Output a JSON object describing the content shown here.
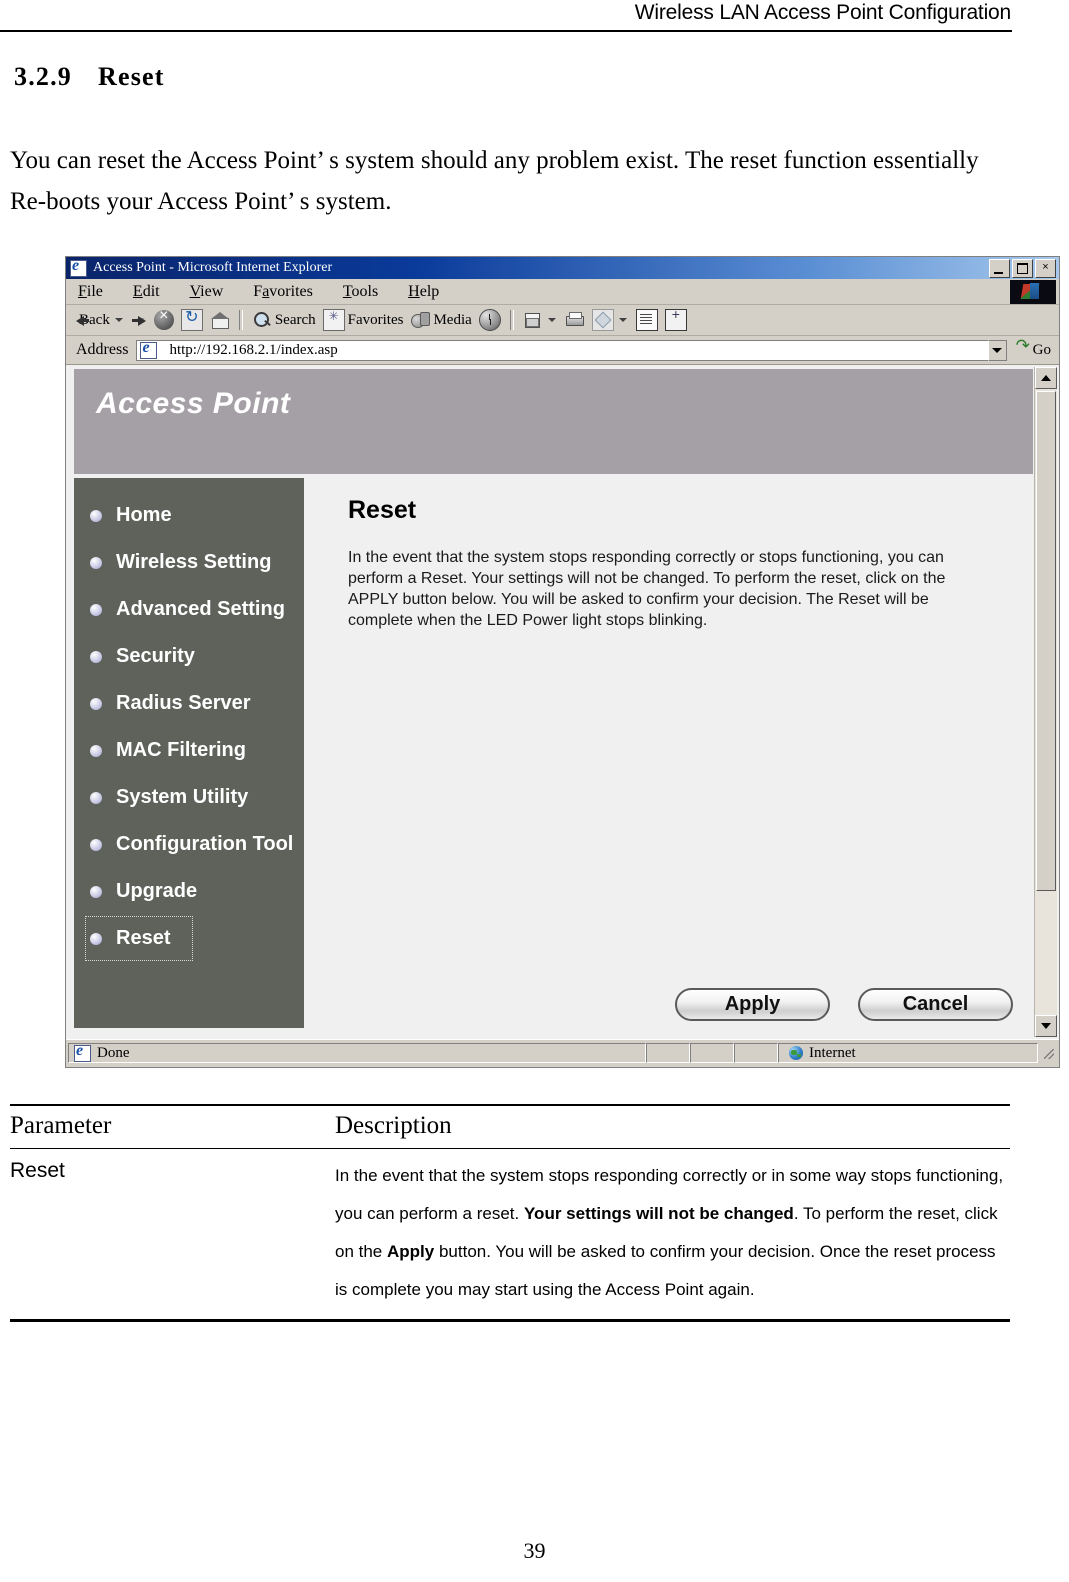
{
  "document": {
    "running_header": "Wireless LAN Access Point Configuration",
    "section_number": "3.2.9",
    "section_title": "Reset",
    "intro_paragraph": "You can reset the Access Point’ s system should any problem exist. The reset function essentially Re-boots your Access Point’ s system.",
    "page_number": "39"
  },
  "browser": {
    "window_title": "Access Point - Microsoft Internet Explorer",
    "window_buttons": {
      "minimize": "_",
      "maximize": "□",
      "close": "×"
    },
    "menu": [
      {
        "label": "File",
        "accel": "F"
      },
      {
        "label": "Edit",
        "accel": "E"
      },
      {
        "label": "View",
        "accel": "V"
      },
      {
        "label": "Favorites",
        "accel": "a"
      },
      {
        "label": "Tools",
        "accel": "T"
      },
      {
        "label": "Help",
        "accel": "H"
      }
    ],
    "toolbar": {
      "back_label": "Back",
      "search_label": "Search",
      "favorites_label": "Favorites",
      "media_label": "Media",
      "icons": [
        "back-arrow-icon",
        "back-dropdown-icon",
        "forward-arrow-icon",
        "forward-dropdown-icon",
        "stop-icon",
        "refresh-icon",
        "home-icon",
        "search-icon",
        "favorites-icon",
        "media-icon",
        "history-icon",
        "mail-icon",
        "mail-dropdown-icon",
        "print-icon",
        "edit-icon",
        "edit-dropdown-icon",
        "discuss-icon",
        "messenger-icon"
      ]
    },
    "address_bar": {
      "label": "Address",
      "url": "http://192.168.2.1/index.asp",
      "go_label": "Go"
    },
    "status_bar": {
      "status_text": "Done",
      "zone_text": "Internet"
    }
  },
  "page": {
    "banner_title": "Access Point",
    "sidebar": [
      {
        "label": "Home",
        "focused": false
      },
      {
        "label": "Wireless Setting",
        "focused": false
      },
      {
        "label": "Advanced Setting",
        "focused": false
      },
      {
        "label": "Security",
        "focused": false
      },
      {
        "label": "Radius Server",
        "focused": false
      },
      {
        "label": "MAC Filtering",
        "focused": false
      },
      {
        "label": "System Utility",
        "focused": false
      },
      {
        "label": "Configuration Tool",
        "focused": false
      },
      {
        "label": "Upgrade",
        "focused": false
      },
      {
        "label": "Reset",
        "focused": true
      }
    ],
    "main": {
      "heading": "Reset",
      "body": "In the event that the system stops responding correctly or stops functioning, you can perform a Reset. Your settings will not be changed. To perform the reset, click on the APPLY button below. You will be asked to confirm your decision. The Reset will be complete when the LED Power light stops blinking.",
      "apply_label": "Apply",
      "cancel_label": "Cancel"
    }
  },
  "parameter_table": {
    "headers": {
      "parameter": "Parameter",
      "description": "Description"
    },
    "rows": [
      {
        "parameter": "Reset",
        "description_parts": [
          {
            "text": "In the event that the system stops responding correctly or in some way stops functioning, you can perform a reset. ",
            "bold": false
          },
          {
            "text": "Your settings will not be changed",
            "bold": true
          },
          {
            "text": ". To perform the reset, click on the ",
            "bold": false
          },
          {
            "text": "Apply",
            "bold": true
          },
          {
            "text": " button. You will be asked to confirm your decision.  Once the reset process is complete you may start using the Access Point  again.",
            "bold": false
          }
        ]
      }
    ]
  },
  "colors": {
    "banner_gray": "#a5a0a5",
    "sidebar_green_gray": "#5e625a",
    "chrome_gray": "#d4d0c8",
    "titlebar_blue": "#0a246a"
  }
}
